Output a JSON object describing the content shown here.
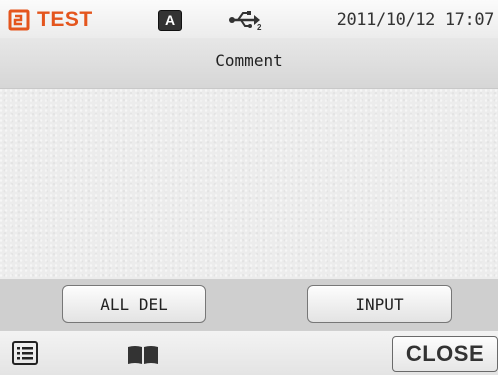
{
  "status_bar": {
    "mode_icon": "mode-icon",
    "mode_label": "TEST",
    "key_badge": "A",
    "usb_icon": "usb-icon",
    "datetime": "2011/10/12 17:07"
  },
  "title_bar": {
    "title": "Comment"
  },
  "comment": {
    "text": ""
  },
  "buttons": {
    "all_del": "ALL DEL",
    "input": "INPUT"
  },
  "bottom_bar": {
    "list_icon": "list-icon",
    "book_icon": "book-icon",
    "close": "CLOSE"
  },
  "colors": {
    "accent": "#e4551d",
    "badge_bg": "#333333",
    "button_row_bg": "#cfcfcf"
  }
}
